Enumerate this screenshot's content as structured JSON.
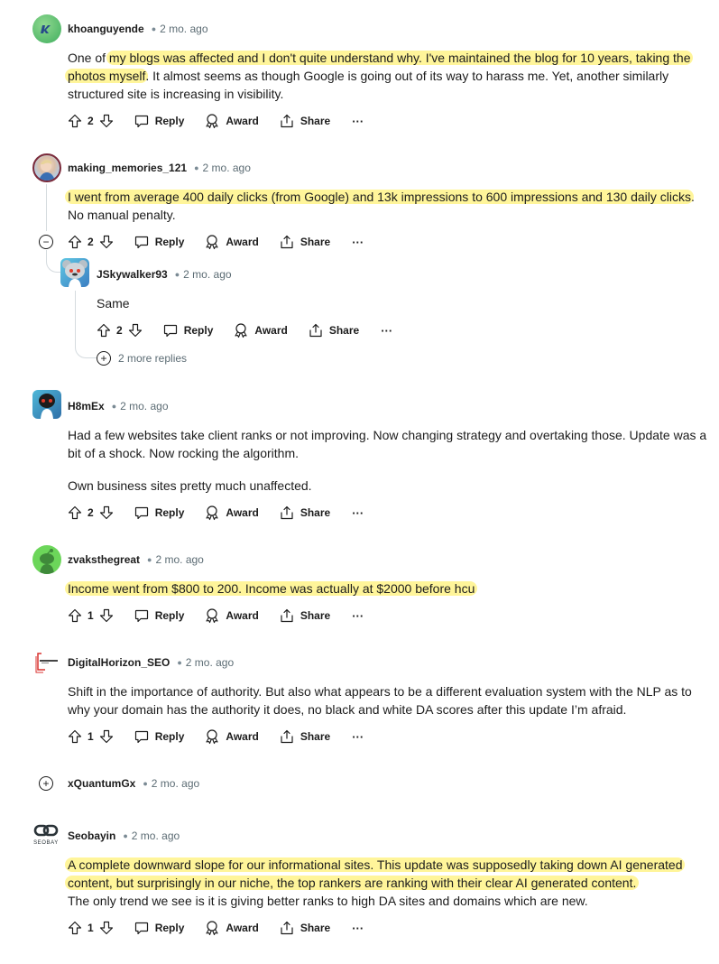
{
  "comments": [
    {
      "author": "khoanguyende",
      "age": "2 mo. ago",
      "avatar": "green-k-logo",
      "body": [
        {
          "t": "One of ",
          "h": false
        },
        {
          "t": "my blogs was affected and I don't quite understand why. I've maintained the blog for 10 years, taking the photos myself",
          "h": true
        },
        {
          "t": ". It almost seems as though Google is going out of its way to harass me. Yet, another similarly structured site is increasing in visibility.",
          "h": false
        }
      ],
      "votes": "2"
    },
    {
      "author": "making_memories_121",
      "age": "2 mo. ago",
      "avatar": "woman-photo",
      "body": [
        {
          "t": "I went from average 400 daily clicks (from Google) and 13k impressions to 600 impressions and 130 daily clicks",
          "h": true
        },
        {
          "t": ". No manual penalty.",
          "h": false
        }
      ],
      "votes": "2",
      "collapse_label": "−"
    },
    {
      "author": "JSkywalker93",
      "age": "2 mo. ago",
      "avatar": "snoo-koala",
      "body": [
        {
          "t": "Same",
          "h": false
        }
      ],
      "votes": "2",
      "more_replies": "2 more replies"
    },
    {
      "author": "H8mEx",
      "age": "2 mo. ago",
      "avatar": "snoo-robot",
      "paragraphs": [
        "Had a few websites take client ranks or not improving. Now changing strategy and overtaking those. Update was a bit of a shock. Now rocking the algorithm.",
        "Own business sites pretty much unaffected."
      ],
      "votes": "2"
    },
    {
      "author": "zvaksthegreat",
      "age": "2 mo. ago",
      "avatar": "snoo-green",
      "body": [
        {
          "t": "Income went from $800 to 200. Income was actually at $2000 before hcu",
          "h": true
        }
      ],
      "votes": "1"
    },
    {
      "author": "DigitalHorizon_SEO",
      "age": "2 mo. ago",
      "avatar": "digital-horizon-logo",
      "body": [
        {
          "t": "Shift in the importance of authority. But also what appears to be a different evaluation system with the NLP as to why your domain has the authority it does, no black and white DA scores after this update I’m afraid.",
          "h": false
        }
      ],
      "votes": "1"
    },
    {
      "author": "xQuantumGx",
      "age": "2 mo. ago",
      "collapsed": true,
      "expand_label": "+"
    },
    {
      "author": "Seobayin",
      "age": "2 mo. ago",
      "avatar": "seobay-logo",
      "avatar_text": "SEOBAY",
      "body": [
        {
          "t": "A complete downward slope for our informational sites. This update was supposedly taking down AI generated content, but surprisingly in our niche, the top rankers are ranking with their clear AI generated content.",
          "h": true
        }
      ],
      "body_tail": "The only trend we see is it is giving better ranks to high DA sites and domains which are new.",
      "votes": "1"
    }
  ],
  "actions": {
    "reply": "Reply",
    "award": "Award",
    "share": "Share",
    "more": "···"
  },
  "colors": {
    "highlight": "#fff59a",
    "thread_line": "#d5dbdf",
    "meta_text": "#5c6c74"
  }
}
